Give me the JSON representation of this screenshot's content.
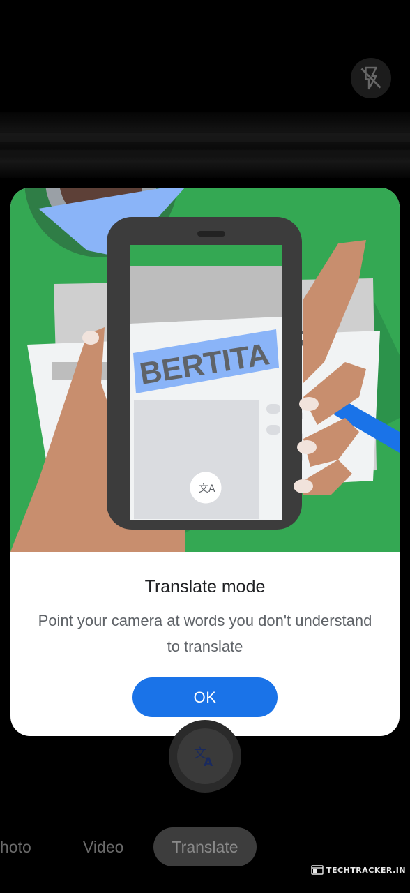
{
  "colors": {
    "accent": "#1a73e8",
    "illustration_bg": "#34a853",
    "background": "#000000"
  },
  "top_bar": {
    "flash_icon": "flash-off-icon"
  },
  "dialog": {
    "illustration": {
      "highlight_word": "BERTITA",
      "partial_word": "R",
      "icon": "translate-icon"
    },
    "title": "Translate mode",
    "body": "Point your camera at words you don't understand to translate",
    "ok_label": "OK"
  },
  "shutter": {
    "icon": "translate-icon"
  },
  "modes": {
    "items": [
      {
        "label": "hoto"
      },
      {
        "label": "Video"
      },
      {
        "label": "Translate",
        "selected": true
      }
    ]
  },
  "watermark": {
    "text": "TECHTRACKER.IN",
    "icon": "browser-window-icon"
  }
}
